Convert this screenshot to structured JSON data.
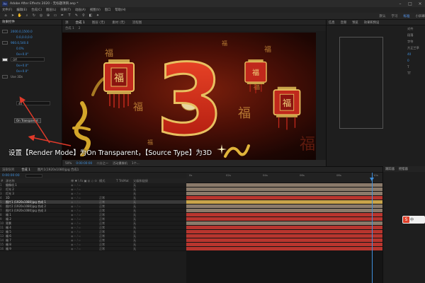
{
  "window": {
    "title": "Adobe After Effects 2020 - 无标题项目.aep *"
  },
  "menu": [
    "文件(F)",
    "编辑(E)",
    "合成(C)",
    "图层(L)",
    "效果(T)",
    "动画(A)",
    "视图(V)",
    "窗口",
    "帮助(H)"
  ],
  "workspace": {
    "items": [
      "默认",
      "学习",
      "标准",
      "小屏幕"
    ],
    "active_index": 2
  },
  "left_panel": {
    "tab": "效果控件",
    "rows": [
      {
        "k": "",
        "v": "2000.0,1500.0"
      },
      {
        "k": "",
        "v": "0.0,0.0,0.0"
      },
      {
        "k": "",
        "v": "960.0,540.0"
      },
      {
        "k": "",
        "v": "0.0%"
      },
      {
        "k": "",
        "v": "0x+0.0°"
      },
      {
        "k": "",
        "v": "Off"
      },
      {
        "k": "",
        "v": "0x+0.0°"
      },
      {
        "k": "",
        "v": "0x+0.0°"
      },
      {
        "k": "",
        "v": "Use 3Ds"
      },
      {
        "k": "",
        "v": "40"
      }
    ],
    "render_mode_value": "On Transparent"
  },
  "viewer": {
    "tabs": [
      "源",
      "合成 1",
      "图层 (无)",
      "素材 (无)",
      "流程图"
    ],
    "active_tab": 1,
    "subtabs": [
      "合成 1",
      "2"
    ],
    "footer": [
      "50%",
      "0:00:00:00",
      "二分之一",
      "活动摄像机",
      "1个..."
    ],
    "canvas": {
      "number": "3",
      "fu_char": "福"
    }
  },
  "right_panel": {
    "tabs": [
      "信息",
      "音频",
      "预览",
      "效果和预设"
    ],
    "side_labels": [
      "对齐",
      "段落",
      "字符",
      "方正兰亭",
      "40",
      "0",
      "T",
      "TT"
    ]
  },
  "caption": "设置【Render Mode】为On Transparent，【Source Type】为3D",
  "timeline": {
    "tabs": [
      "渲染队列",
      "合成 1",
      "图片1(1920x1080)jpg 合成1"
    ],
    "active_tab": 1,
    "timecode": "0:00:00:00",
    "headers": {
      "num": "#",
      "name": "源名称",
      "switches": "单 ✱ \\ fx ▣ ◎ ◇ ⊙",
      "mode": "模式",
      "trkmat": "T TrkMat",
      "parent": "父级和链接"
    },
    "ruler": [
      "0s",
      "02s",
      "04s",
      "06s",
      "08s",
      "10s"
    ],
    "layers": [
      {
        "num": "1",
        "name": "摄像机 1",
        "mode": "",
        "parent": "无"
      },
      {
        "num": "2",
        "name": "灯光 2",
        "mode": "",
        "parent": "无"
      },
      {
        "num": "3",
        "name": "灯光 3",
        "mode": "",
        "parent": "无"
      },
      {
        "num": "4",
        "name": "3D",
        "mode": "正常",
        "parent": "无"
      },
      {
        "num": "5",
        "name": "图片1 (1920x1080)jpg 合成 1",
        "mode": "正常",
        "parent": "无"
      },
      {
        "num": "6",
        "name": "图片2 (1920x1080)jpg 合成 2",
        "mode": "正常",
        "parent": "无"
      },
      {
        "num": "7",
        "name": "图片3 (1920x1080)jpg 合成 3",
        "mode": "正常",
        "parent": "无"
      },
      {
        "num": "8",
        "name": "福 1",
        "mode": "正常",
        "parent": "无"
      },
      {
        "num": "9",
        "name": "福 2",
        "mode": "正常",
        "parent": "无"
      },
      {
        "num": "10",
        "name": "背景",
        "mode": "正常",
        "parent": "无"
      },
      {
        "num": "11",
        "name": "福 4",
        "mode": "正常",
        "parent": "无"
      },
      {
        "num": "12",
        "name": "福 5",
        "mode": "正常",
        "parent": "无"
      },
      {
        "num": "13",
        "name": "福 6",
        "mode": "正常",
        "parent": "无"
      },
      {
        "num": "14",
        "name": "福 7",
        "mode": "正常",
        "parent": "无"
      },
      {
        "num": "15",
        "name": "福 8",
        "mode": "正常",
        "parent": "无"
      },
      {
        "num": "16",
        "name": "福 9",
        "mode": "正常",
        "parent": "无"
      }
    ],
    "selected_layer_index": 4,
    "track_colors": [
      "#8a7a6a",
      "#8a7a6a",
      "#8a7a6a",
      "#b8352e",
      "#c9a44a",
      "#8a7a6a",
      "#8a7a6a",
      "#b8352e",
      "#b8352e",
      "#8a7a6a",
      "#b8352e",
      "#b8352e",
      "#b8352e",
      "#b8352e",
      "#b8352e",
      "#b8352e"
    ]
  },
  "lower_right": {
    "tabs": [
      "跟踪器",
      "摇摆器"
    ]
  },
  "ime": {
    "label": "中"
  },
  "colors": {
    "accent_blue": "#3f8fdc",
    "caption_white": "#ffffff",
    "arrow_red": "#e03a2a"
  }
}
